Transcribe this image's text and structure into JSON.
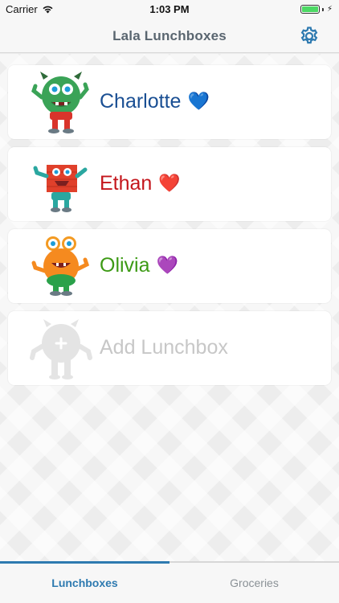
{
  "status_bar": {
    "carrier": "Carrier",
    "time": "1:03 PM"
  },
  "nav": {
    "title": "Lala Lunchboxes",
    "settings_icon": "gear-icon"
  },
  "lunchboxes": [
    {
      "name": "Charlotte",
      "heart": "💙",
      "color": "#1a4f93",
      "avatar": "green-monster-icon"
    },
    {
      "name": "Ethan",
      "heart": "❤️",
      "color": "#c4161c",
      "avatar": "red-square-monster-icon"
    },
    {
      "name": "Olivia",
      "heart": "💜",
      "color": "#3c9a14",
      "avatar": "orange-monster-icon"
    }
  ],
  "add": {
    "label": "Add Lunchbox",
    "avatar": "placeholder-monster-icon"
  },
  "tabs": [
    {
      "label": "Lunchboxes",
      "active": true
    },
    {
      "label": "Groceries",
      "active": false
    }
  ],
  "colors": {
    "accent": "#2e7ab0",
    "nav_title": "#5a6670",
    "card_bg": "#ffffff"
  }
}
